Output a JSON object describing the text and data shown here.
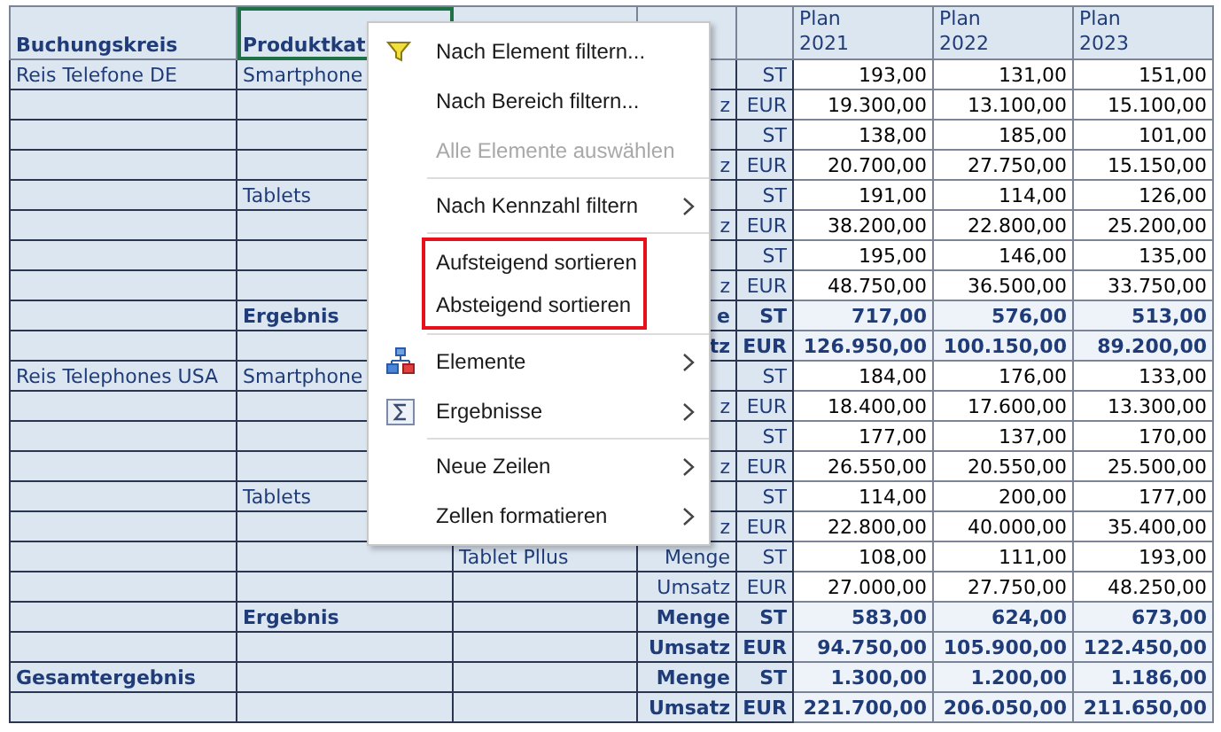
{
  "table": {
    "columns": [
      {
        "label": "Buchungskreis",
        "selected": false
      },
      {
        "label": "Produktkat",
        "selected": true
      },
      {},
      {},
      {},
      {
        "label": "Plan",
        "sub": "2021"
      },
      {
        "label": "Plan",
        "sub": "2022"
      },
      {
        "label": "Plan",
        "sub": "2023"
      }
    ],
    "rows": [
      {
        "kind": "detail",
        "company": "Reis Telefone DE",
        "category": "Smartphone",
        "unit": "ST",
        "values": [
          "193,00",
          "131,00",
          "151,00"
        ]
      },
      {
        "kind": "detail",
        "measure": "z",
        "unit": "EUR",
        "values": [
          "19.300,00",
          "13.100,00",
          "15.100,00"
        ]
      },
      {
        "kind": "detail",
        "unit": "ST",
        "values": [
          "138,00",
          "185,00",
          "101,00"
        ]
      },
      {
        "kind": "detail",
        "measure": "z",
        "unit": "EUR",
        "values": [
          "20.700,00",
          "27.750,00",
          "15.150,00"
        ]
      },
      {
        "kind": "detail",
        "category": "Tablets",
        "unit": "ST",
        "values": [
          "191,00",
          "114,00",
          "126,00"
        ]
      },
      {
        "kind": "detail",
        "measure": "z",
        "unit": "EUR",
        "values": [
          "38.200,00",
          "22.800,00",
          "25.200,00"
        ]
      },
      {
        "kind": "detail",
        "unit": "ST",
        "values": [
          "195,00",
          "146,00",
          "135,00"
        ]
      },
      {
        "kind": "detail",
        "measure": "z",
        "unit": "EUR",
        "values": [
          "48.750,00",
          "36.500,00",
          "33.750,00"
        ]
      },
      {
        "kind": "subtotal",
        "category": "Ergebnis",
        "measure": "e",
        "unit": "ST",
        "values": [
          "717,00",
          "576,00",
          "513,00"
        ]
      },
      {
        "kind": "subtotal",
        "measure": "tz",
        "unit": "EUR",
        "values": [
          "126.950,00",
          "100.150,00",
          "89.200,00"
        ]
      },
      {
        "kind": "detail",
        "company": "Reis Telephones USA",
        "category": "Smartphone",
        "unit": "ST",
        "values": [
          "184,00",
          "176,00",
          "133,00"
        ]
      },
      {
        "kind": "detail",
        "measure": "z",
        "unit": "EUR",
        "values": [
          "18.400,00",
          "17.600,00",
          "13.300,00"
        ]
      },
      {
        "kind": "detail",
        "unit": "ST",
        "values": [
          "177,00",
          "137,00",
          "170,00"
        ]
      },
      {
        "kind": "detail",
        "measure": "z",
        "unit": "EUR",
        "values": [
          "26.550,00",
          "20.550,00",
          "25.500,00"
        ]
      },
      {
        "kind": "detail",
        "category": "Tablets",
        "unit": "ST",
        "values": [
          "114,00",
          "200,00",
          "177,00"
        ]
      },
      {
        "kind": "detail",
        "measure": "z",
        "unit": "EUR",
        "values": [
          "22.800,00",
          "40.000,00",
          "35.400,00"
        ]
      },
      {
        "kind": "detail",
        "product": "Tablet Pllus",
        "measure": "Menge",
        "unit": "ST",
        "values": [
          "108,00",
          "111,00",
          "193,00"
        ]
      },
      {
        "kind": "detail",
        "measure": "Umsatz",
        "unit": "EUR",
        "values": [
          "27.000,00",
          "27.750,00",
          "48.250,00"
        ]
      },
      {
        "kind": "subtotal",
        "category": "Ergebnis",
        "measure": "Menge",
        "unit": "ST",
        "values": [
          "583,00",
          "624,00",
          "673,00"
        ]
      },
      {
        "kind": "subtotal",
        "measure": "Umsatz",
        "unit": "EUR",
        "values": [
          "94.750,00",
          "105.900,00",
          "122.450,00"
        ]
      },
      {
        "kind": "total",
        "company": "Gesamtergebnis",
        "measure": "Menge",
        "unit": "ST",
        "values": [
          "1.300,00",
          "1.200,00",
          "1.186,00"
        ]
      },
      {
        "kind": "total",
        "measure": "Umsatz",
        "unit": "EUR",
        "values": [
          "221.700,00",
          "206.050,00",
          "211.650,00"
        ]
      }
    ]
  },
  "context_menu": {
    "groups": [
      {
        "highlighted": false,
        "items": [
          {
            "label": "Nach Element filtern...",
            "kind": "filter",
            "disabled": false,
            "submenu": false
          },
          {
            "label": "Nach Bereich filtern...",
            "disabled": false,
            "submenu": false
          },
          {
            "label": "Alle Elemente auswählen",
            "disabled": true,
            "submenu": false
          }
        ]
      },
      {
        "highlighted": false,
        "items": [
          {
            "label": "Nach Kennzahl filtern",
            "disabled": false,
            "submenu": true
          }
        ]
      },
      {
        "highlighted": true,
        "items": [
          {
            "label": "Aufsteigend sortieren",
            "disabled": false,
            "submenu": false
          },
          {
            "label": "Absteigend sortieren",
            "disabled": false,
            "submenu": false
          }
        ]
      },
      {
        "highlighted": false,
        "items": [
          {
            "label": "Elemente",
            "kind": "hierarchy",
            "disabled": false,
            "submenu": true
          },
          {
            "label": "Ergebnisse",
            "kind": "sum",
            "disabled": false,
            "submenu": true
          }
        ]
      },
      {
        "highlighted": false,
        "items": [
          {
            "label": "Neue Zeilen",
            "disabled": false,
            "submenu": true
          },
          {
            "label": "Zellen formatieren",
            "disabled": false,
            "submenu": true
          }
        ]
      }
    ]
  }
}
